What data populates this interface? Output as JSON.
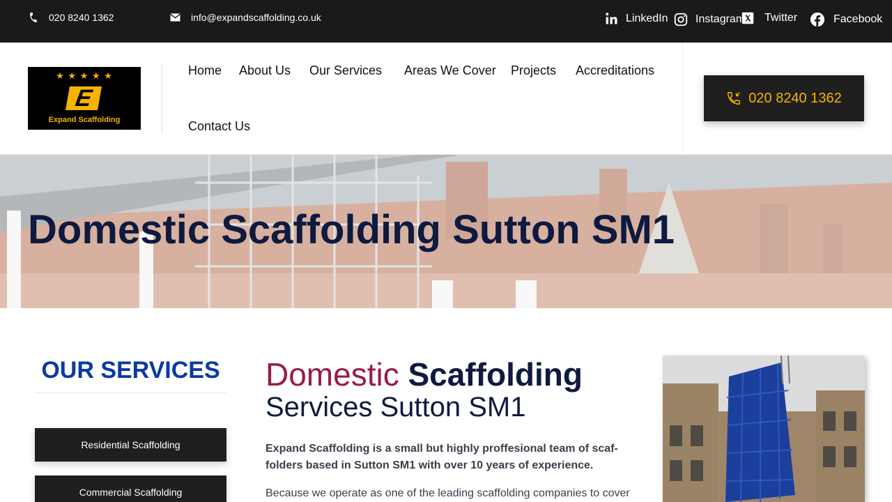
{
  "topbar": {
    "phone": "020 8240 1362",
    "email": "info@expandscaffolding.co.uk",
    "social": [
      "LinkedIn",
      "Instagram",
      "Twitter",
      "Facebook"
    ]
  },
  "logo": {
    "stars": "★ ★ ★ ★ ★",
    "letter": "E",
    "name": "Expand Scaffolding"
  },
  "nav": [
    "Home",
    "About Us",
    "Our Services",
    "Areas We Cover",
    "Projects",
    "Accreditations",
    "Contact Us"
  ],
  "call_button": "020 8240 1362",
  "hero": {
    "title": "Domestic Scaffolding Sutton SM1"
  },
  "sidebar": {
    "title": "OUR SERVICES",
    "items": [
      "Residential Scaffolding",
      "Commercial Scaffolding"
    ]
  },
  "main": {
    "heading_light": "Domestic",
    "heading_bold": "Scaffolding",
    "heading_line2": "Services Sutton SM1",
    "intro": "Expand Scaffolding is a small but highly proffesional team of scaf-folders based in Sutton SM1 with over 10 years of experience.",
    "paragraph": "Because we operate as one of the leading scaffolding companies to cover"
  },
  "colors": {
    "accent": "#f5b400",
    "dark": "#1f1f1f",
    "navy": "#0e1a3f",
    "maroon": "#9a1c43",
    "blue": "#0b3aa4"
  },
  "icons": [
    "phone-icon",
    "mail-icon",
    "linkedin-icon",
    "instagram-icon",
    "twitter-icon",
    "facebook-icon",
    "phone-call-icon"
  ]
}
